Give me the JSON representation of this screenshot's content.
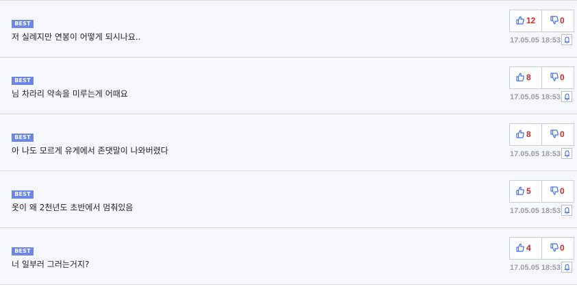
{
  "comments": [
    {
      "badge": "BEST",
      "text": "저 실례지만 연봉이 어떻게 되시나요..",
      "up": "12",
      "down": "0",
      "date": "17.05.05 18:53"
    },
    {
      "badge": "BEST",
      "text": "님 차라리 약속을 미루는게 어때요",
      "up": "8",
      "down": "0",
      "date": "17.05.05 18:53"
    },
    {
      "badge": "BEST",
      "text": "아 나도 모르게 유게에서 존댓말이 나와버렸다",
      "up": "8",
      "down": "0",
      "date": "17.05.05 18:53"
    },
    {
      "badge": "BEST",
      "text": "옷이 왜 2천년도 초반에서 멈춰있음",
      "up": "5",
      "down": "0",
      "date": "17.05.05 18:53"
    },
    {
      "badge": "BEST",
      "text": "너 일부러 그러는거지?",
      "up": "4",
      "down": "0",
      "date": "17.05.05 18:53"
    }
  ],
  "icons": {
    "upvote": "thumbs-up-icon",
    "downvote": "thumbs-down-icon",
    "report": "bell-icon"
  },
  "colors": {
    "badge": "#6b86e6",
    "count": "#d2261f",
    "thumb": "#3d6fe0",
    "date": "#9a9ea8",
    "row_bg": "#f5f7fb"
  }
}
